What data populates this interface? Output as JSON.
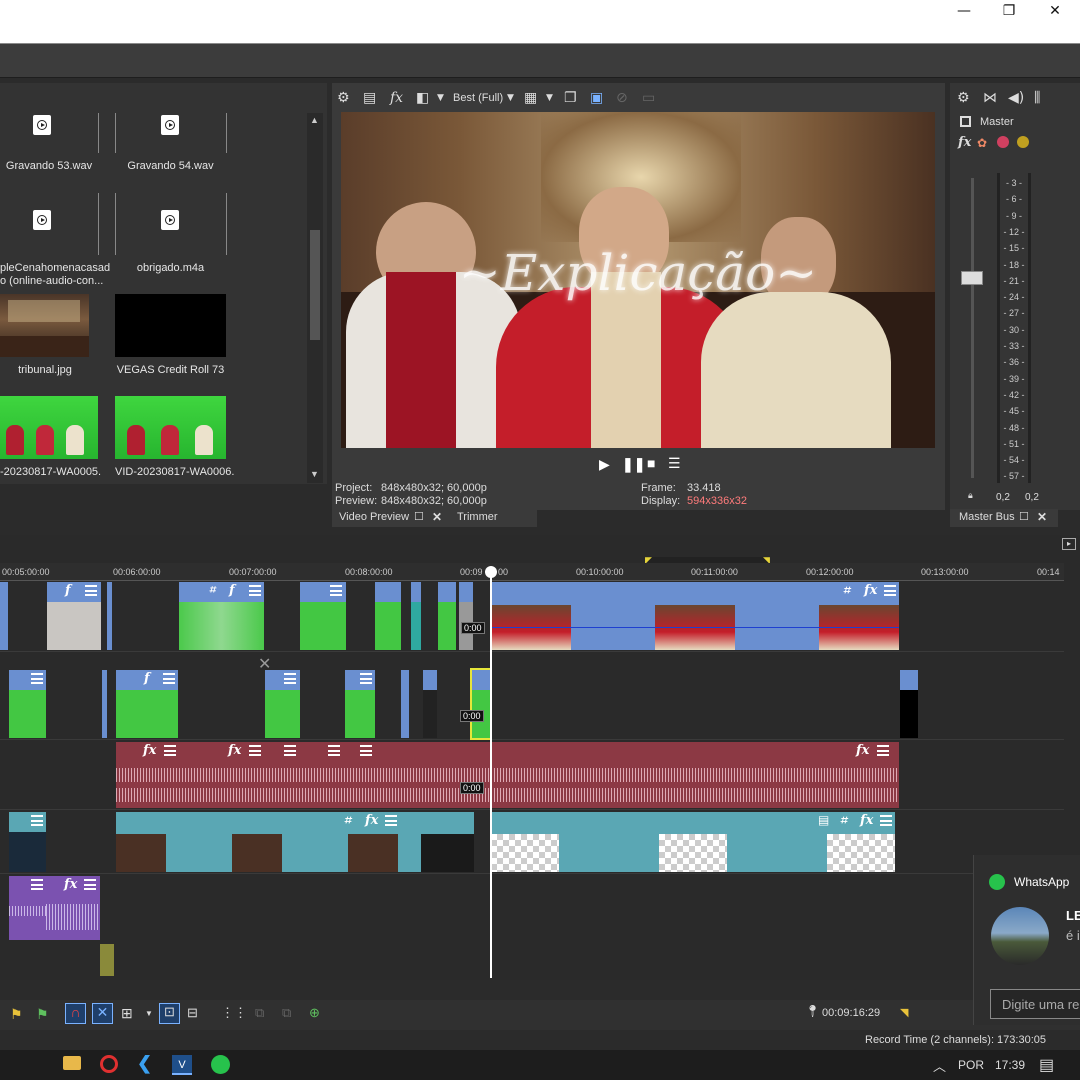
{
  "window": {
    "minimize": "—",
    "maximize": "❐",
    "close": "✕"
  },
  "media": {
    "items": [
      {
        "label": "Gravando 53.wav",
        "type": "audio"
      },
      {
        "label": "Gravando 54.wav",
        "type": "audio"
      },
      {
        "label1": "pleCenahomenacasad",
        "label2": "o (online-audio-con...",
        "type": "audio"
      },
      {
        "label": "obrigado.m4a",
        "type": "audio"
      },
      {
        "label": "tribunal.jpg",
        "type": "image"
      },
      {
        "label": "VEGAS Credit Roll 73",
        "type": "media"
      },
      {
        "label": "-20230817-WA0005.",
        "type": "video"
      },
      {
        "label": "VID-20230817-WA0006.",
        "type": "video"
      }
    ]
  },
  "preview": {
    "quality": "Best (Full)",
    "overlay_text": "~Explicação~",
    "project_label": "Project:",
    "project_value": "848x480x32; 60,000p",
    "preview_label": "Preview:",
    "preview_value": "848x480x32; 60,000p",
    "frame_label": "Frame:",
    "frame_value": "33.418",
    "display_label": "Display:",
    "display_value": "594x336x32",
    "tab_video_preview": "Video Preview",
    "tab_trimmer": "Trimmer"
  },
  "master": {
    "label": "Master",
    "scale": [
      "3",
      "6",
      "9",
      "12",
      "15",
      "18",
      "21",
      "24",
      "27",
      "30",
      "33",
      "36",
      "39",
      "42",
      "45",
      "48",
      "51",
      "54",
      "57"
    ],
    "left_value": "0,2",
    "right_value": "0,2",
    "tab": "Master Bus"
  },
  "timeline": {
    "ruler": [
      "00:05:00:00",
      "00:06:00:00",
      "00:07:00:00",
      "00:08:00:00",
      "00:09",
      "00",
      "00:10:00:00",
      "00:11:00:00",
      "00:12:00:00",
      "00:13:00:00",
      "00:14"
    ],
    "clip_time": "0:00",
    "cursor_time": "00:09:16:29"
  },
  "status": {
    "record_time": "Record Time (2 channels): 173:30:05"
  },
  "taskbar": {
    "lang": "POR",
    "time": "17:39"
  },
  "whatsapp": {
    "title": "WhatsApp",
    "name": "LE",
    "line2": "é i",
    "reply_placeholder": "Digite uma re"
  },
  "colors": {
    "accent_blue": "#6a8fd0",
    "audio_red": "#8c3944",
    "teal": "#5aa7b4",
    "purple": "#7b52b0",
    "display_value": "#ff7b7b"
  }
}
